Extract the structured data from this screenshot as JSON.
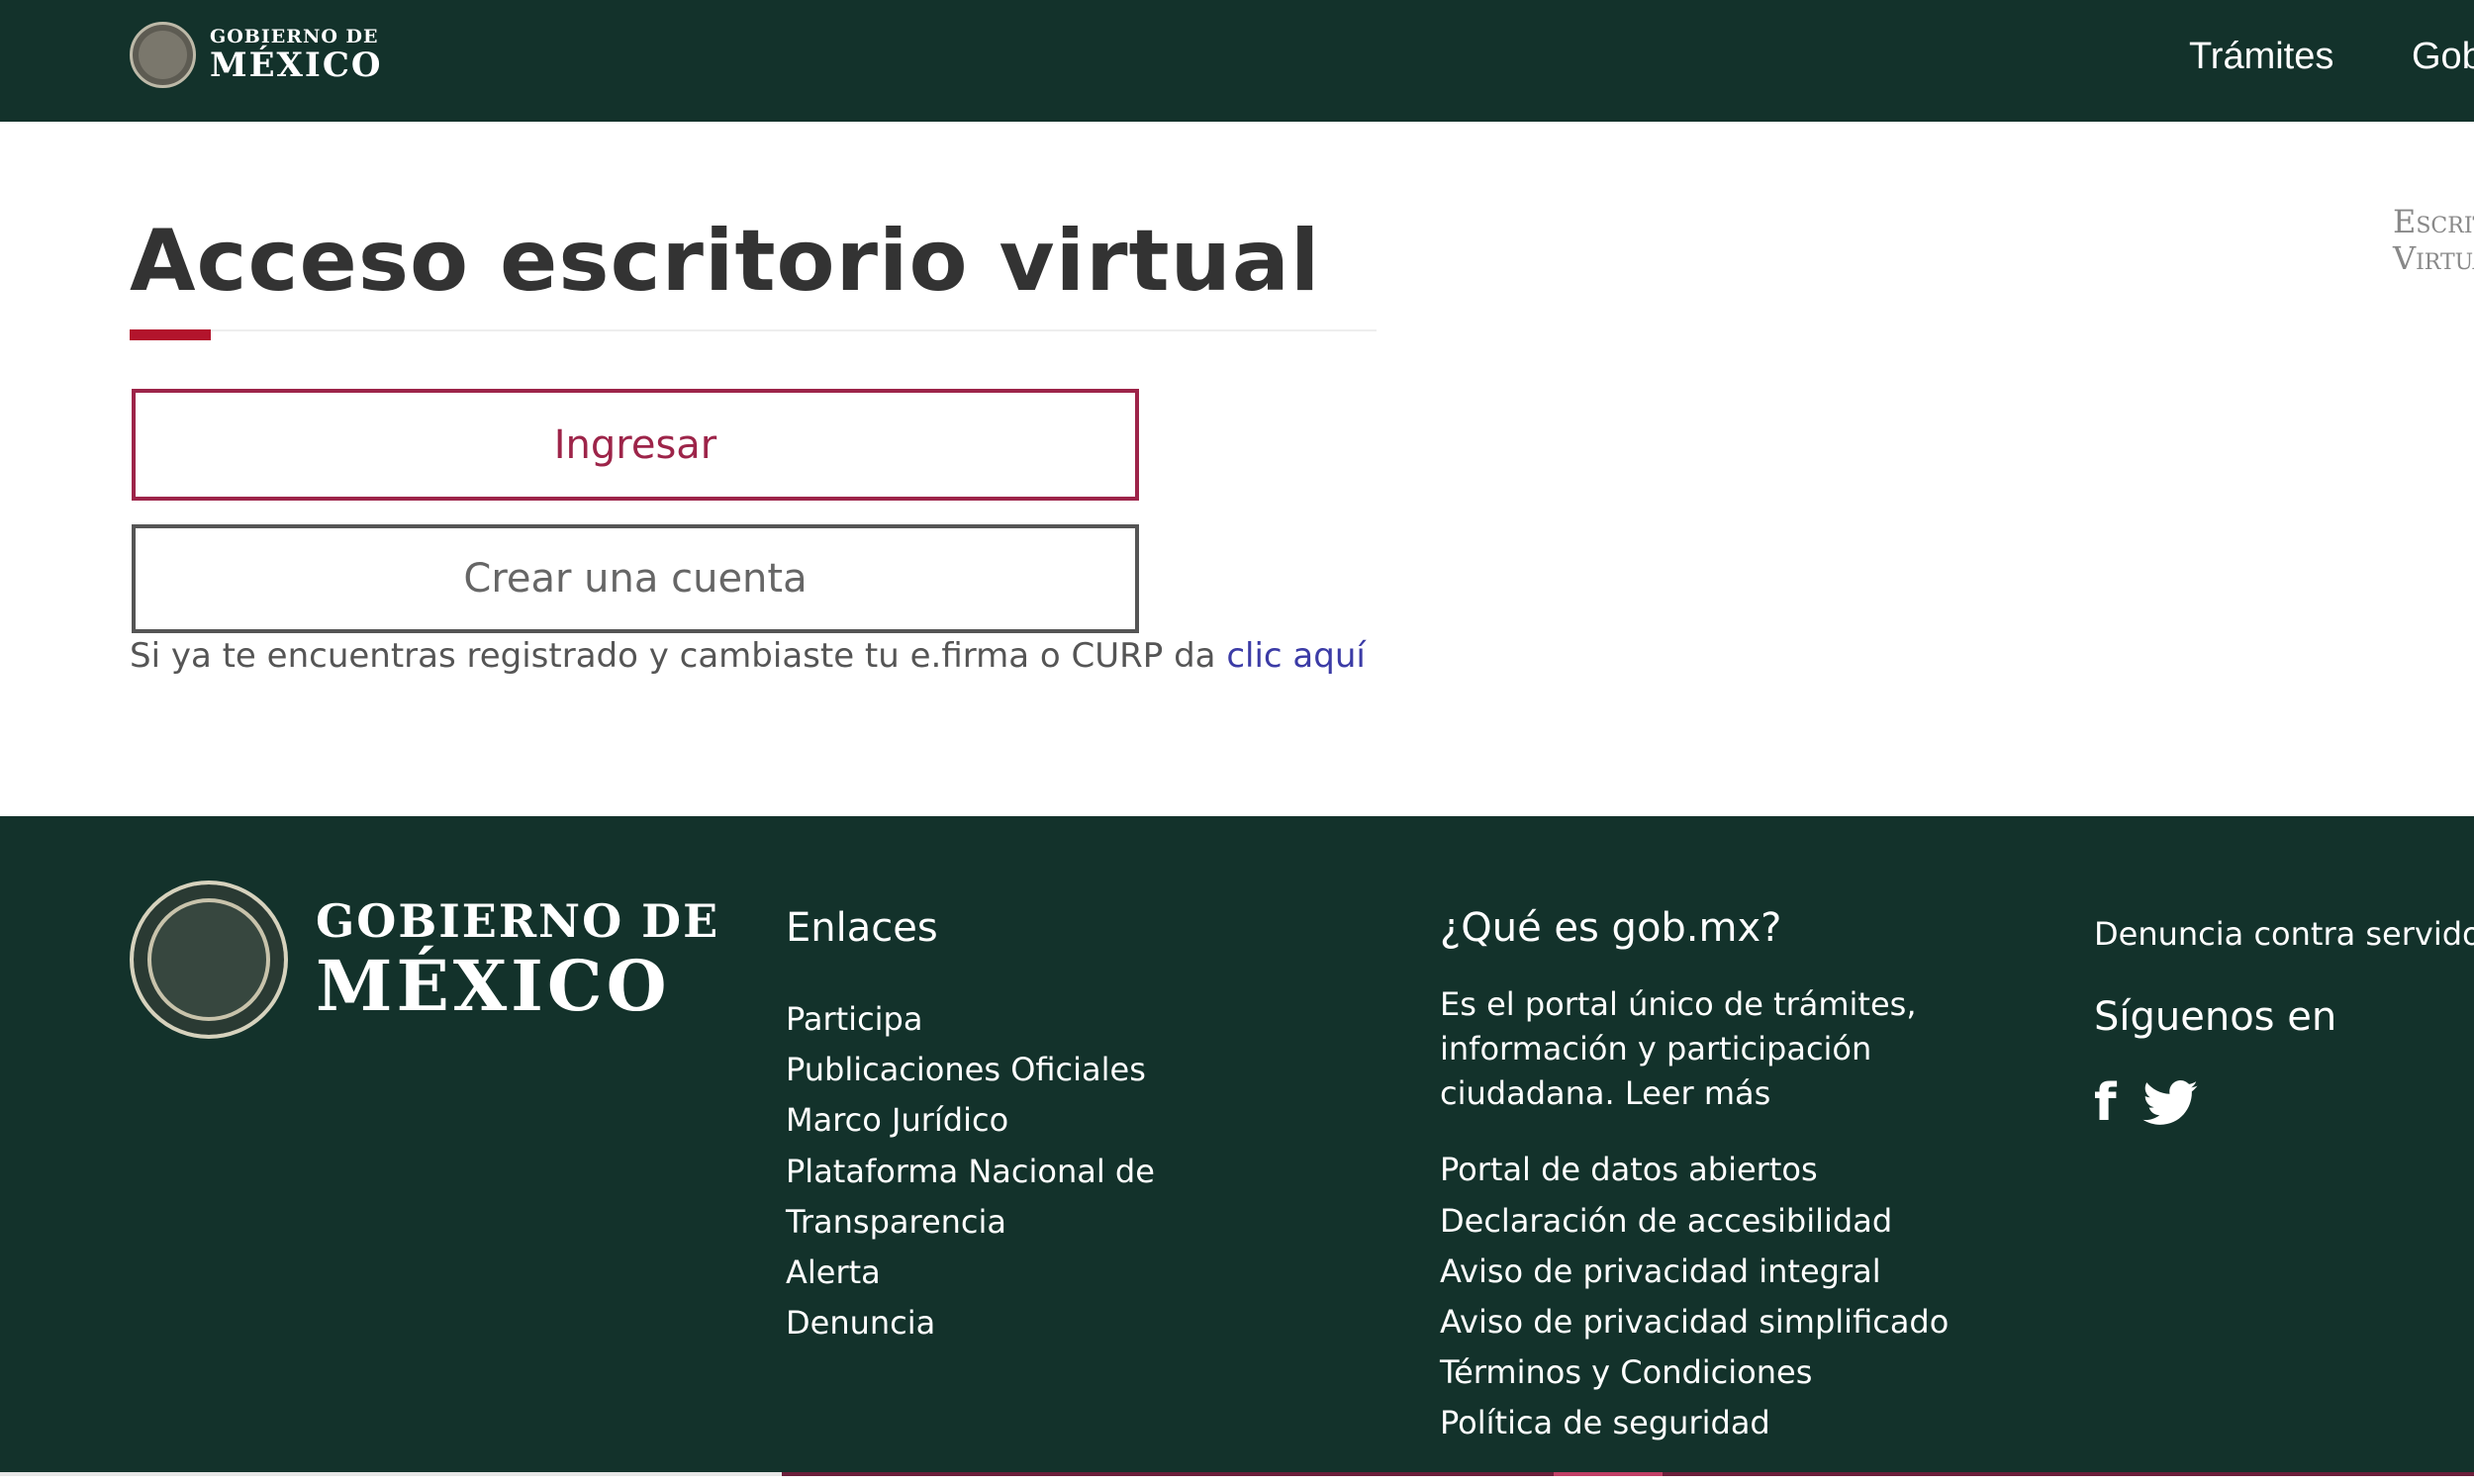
{
  "topbar": {
    "logo_small": "GOBIERNO DE",
    "logo_big": "MÉXICO",
    "nav": [
      "Trámites",
      "Gobierno"
    ],
    "background": "#13322b"
  },
  "main": {
    "title": "Acceso escritorio virtual",
    "accent_color": "#b3142c",
    "ingresar_label": "Ingresar",
    "crear_label": "Crear una cuenta",
    "helper_text": "Si ya te encuentras registrado y cambiaste tu e.firma o CURP da ",
    "helper_link": "clic aquí",
    "side_label_line1": "Escritorio",
    "side_label_line2": "Virtual"
  },
  "footer": {
    "logo_line1": "GOBIERNO DE",
    "logo_line2": "MÉXICO",
    "enlaces": {
      "title": "Enlaces",
      "items": [
        "Participa",
        "Publicaciones Oficiales",
        "Marco Jurídico",
        "Plataforma Nacional de Transparencia",
        "Alerta",
        "Denuncia"
      ]
    },
    "que_es": {
      "title": "¿Qué es gob.mx?",
      "description": "Es el portal único de trámites, información y participación ciudadana. Leer más",
      "items": [
        "Portal de datos abiertos",
        "Declaración de accesibilidad",
        "Aviso de privacidad integral",
        "Aviso de privacidad simplificado",
        "Términos y Condiciones",
        "Política de seguridad"
      ]
    },
    "redes": {
      "denuncia": "Denuncia contra servidores públicos",
      "siguenos": "Síguenos en",
      "facebook": "f",
      "icons": [
        "facebook-icon",
        "twitter-icon"
      ]
    }
  }
}
